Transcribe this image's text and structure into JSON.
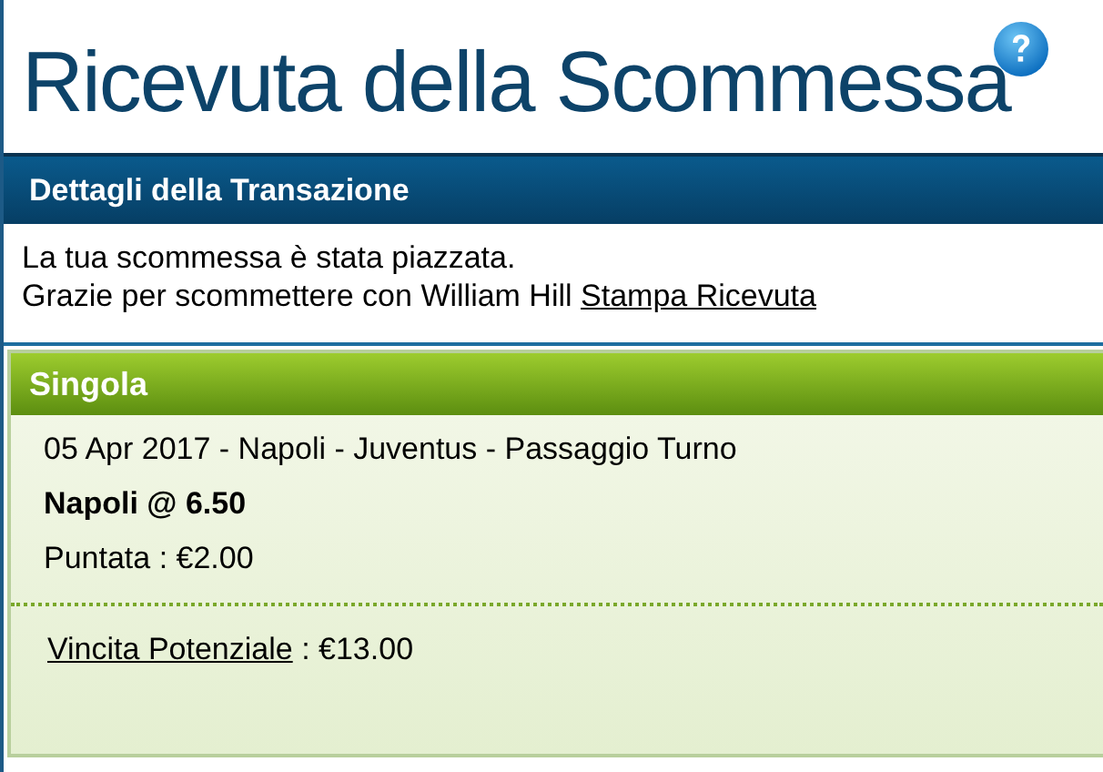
{
  "title": "Ricevuta della Scommessa",
  "section": {
    "title": "Dettagli della Transazione"
  },
  "messages": [
    "La tua scommessa è stata piazzata."
  ],
  "thanks": {
    "text": "Grazie per scommettere con William Hill",
    "link": "Stampa Ricevuta"
  },
  "bet": {
    "type": "Singola",
    "event": "05 Apr 2017 - Napoli - Juventus - Passaggio Turno",
    "selection": "Napoli @ 6.50",
    "stake": "Puntata : €2.00",
    "return_link": "Vincita Potenziale",
    "return_value": ": €13.00"
  }
}
